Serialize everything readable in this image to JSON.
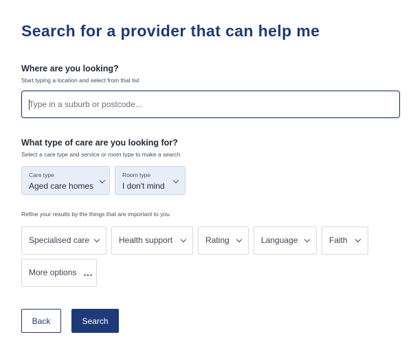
{
  "page": {
    "title": "Search for a provider that can help me"
  },
  "location": {
    "heading": "Where are you looking?",
    "hint": "Start typing a location and select from that list",
    "placeholder": "Type in a suburb or postcode..."
  },
  "care": {
    "heading": "What type of care are you looking for?",
    "hint": "Select a care type and service or room type to make a search",
    "care_type": {
      "label": "Care type",
      "value": "Aged care homes"
    },
    "room_type": {
      "label": "Room type",
      "value": "I don't mind"
    }
  },
  "refine": {
    "hint": "Refine your results by the things that are important to you",
    "filters": [
      {
        "label": "Specialised care",
        "icon": "chevron-down-icon"
      },
      {
        "label": "Health support",
        "icon": "chevron-down-icon"
      },
      {
        "label": "Rating",
        "icon": "chevron-down-icon"
      },
      {
        "label": "Language",
        "icon": "chevron-down-icon"
      },
      {
        "label": "Faith",
        "icon": "chevron-down-icon"
      }
    ],
    "more": {
      "label": "More options",
      "icon": "more-dots-icon"
    }
  },
  "actions": {
    "back_label": "Back",
    "search_label": "Search"
  },
  "colors": {
    "brand": "#1e3a78",
    "select_bg": "#e8eef8",
    "filter_border": "#d6d9de"
  }
}
